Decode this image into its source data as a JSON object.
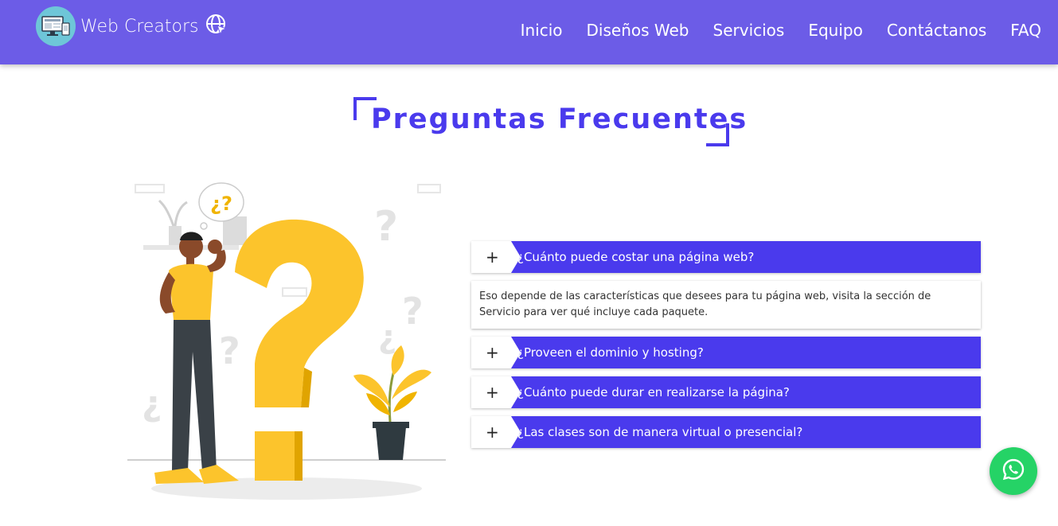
{
  "brand": {
    "name": "Web Creators"
  },
  "nav": {
    "items": [
      "Inicio",
      "Diseños Web",
      "Servicios",
      "Equipo",
      "Contáctanos",
      "FAQ"
    ]
  },
  "page": {
    "title": "Preguntas Frecuentes"
  },
  "faq": {
    "items": [
      {
        "icon": "+",
        "question": "¿Cuánto puede costar una página web?",
        "answer": "Eso depende de las características que desees para tu página web, visita la sección de Servicio para ver qué incluye cada paquete.",
        "expanded": true
      },
      {
        "icon": "+",
        "question": "¿Proveen el dominio y hosting?",
        "expanded": false
      },
      {
        "icon": "+",
        "question": "¿Cuánto puede durar en realizarse la página?",
        "expanded": false
      },
      {
        "icon": "+",
        "question": "¿Las clases son de manera virtual o presencial?",
        "expanded": false
      }
    ]
  },
  "illustration": {
    "bubble_text": "¿?"
  },
  "colors": {
    "nav_bg": "#6c5ce7",
    "accent": "#4a3aed",
    "whatsapp": "#25d366",
    "question_mark": "#fcc42c"
  },
  "icons": {
    "logo": "monitor-logo-icon",
    "globe": "globe-cursor-icon",
    "whatsapp": "whatsapp-icon"
  }
}
